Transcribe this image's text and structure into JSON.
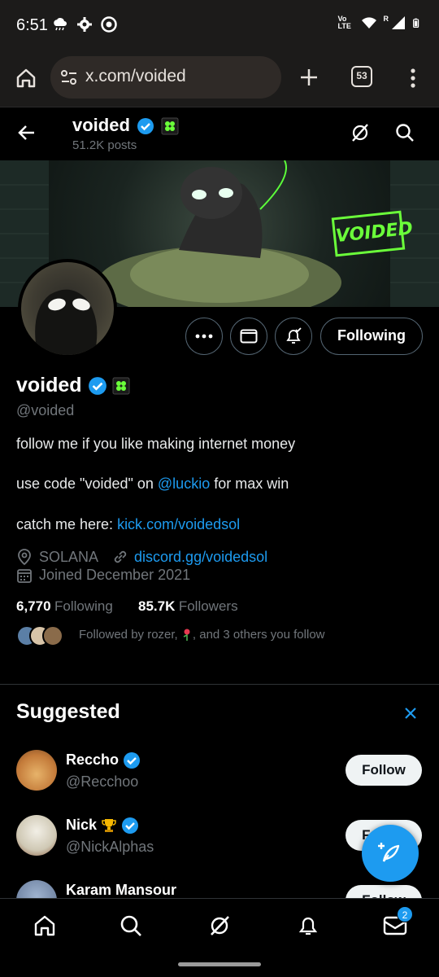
{
  "status_bar": {
    "time": "6:51",
    "network_label": "Vo LTE",
    "signal_indicator": "R"
  },
  "browser": {
    "url": "x.com/voided",
    "tab_count": "53"
  },
  "header": {
    "name": "voided",
    "posts": "51.2K posts"
  },
  "banner": {
    "logo_text": "VOIDED"
  },
  "profile": {
    "name": "voided",
    "handle": "@voided",
    "follow_button": "Following",
    "bio_line1": "follow me if you like making internet money",
    "bio_line2_pre": "use code \"voided\" on ",
    "bio_line2_link": "@luckio",
    "bio_line2_post": " for max win",
    "bio_line3_pre": "catch me here: ",
    "bio_line3_link": "kick.com/voidedsol",
    "location": "SOLANA",
    "website": "discord.gg/voidedsol",
    "joined": "Joined December 2021",
    "following_count": "6,770",
    "following_label": "Following",
    "followers_count": "85.7K",
    "followers_label": "Followers",
    "followed_by_pre": "Followed by rozer, ",
    "followed_by_post": ", and 3 others you follow"
  },
  "suggested": {
    "title": "Suggested",
    "items": [
      {
        "name": "Reccho",
        "handle": "@Recchoo",
        "button": "Follow"
      },
      {
        "name": "Nick",
        "handle": "@NickAlphas",
        "button": "Follow"
      },
      {
        "name": "Karam Mansour",
        "handle": "",
        "button": "Follow"
      }
    ]
  },
  "nav": {
    "messages_badge": "2"
  },
  "colors": {
    "accent": "#1d9bf0",
    "background": "#000000",
    "muted": "#71767b"
  }
}
